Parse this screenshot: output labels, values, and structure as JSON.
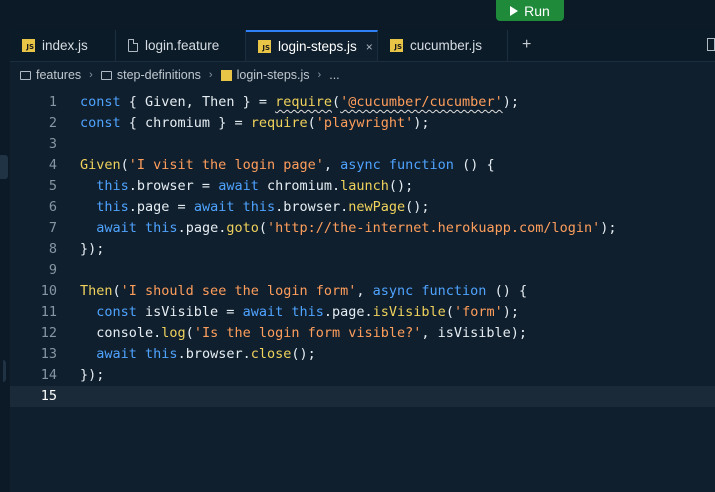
{
  "toolbar": {
    "run_label": "Run"
  },
  "tabs": [
    {
      "label": "index.js",
      "icon": "js-file-icon",
      "active": false
    },
    {
      "label": "login.feature",
      "icon": "file-icon",
      "active": false
    },
    {
      "label": "login-steps.js",
      "icon": "js-file-icon",
      "active": true,
      "closable": true
    },
    {
      "label": "cucumber.js",
      "icon": "js-file-icon",
      "active": false
    }
  ],
  "icons": {
    "close": "×",
    "plus": "+",
    "chevron": "›",
    "js_badge": "JS"
  },
  "breadcrumb": {
    "items": [
      "features",
      "step-definitions",
      "login-steps.js"
    ],
    "ellipsis": "..."
  },
  "editor": {
    "current_line": 15,
    "lines": [
      {
        "n": "1",
        "tokens": [
          [
            "kw",
            "const"
          ],
          [
            "pl",
            " { "
          ],
          [
            "pl",
            "Given"
          ],
          [
            "pl",
            ", "
          ],
          [
            "pl",
            "Then"
          ],
          [
            "pl",
            " } = "
          ],
          [
            "fn sq",
            "require"
          ],
          [
            "pl",
            "("
          ],
          [
            "str sq",
            "'@cucumber/cucumber'"
          ],
          [
            "pl",
            ");"
          ]
        ]
      },
      {
        "n": "2",
        "tokens": [
          [
            "kw",
            "const"
          ],
          [
            "pl",
            " { "
          ],
          [
            "pl",
            "chromium"
          ],
          [
            "pl",
            " } = "
          ],
          [
            "fn",
            "require"
          ],
          [
            "pl",
            "("
          ],
          [
            "str",
            "'playwright'"
          ],
          [
            "pl",
            ");"
          ]
        ]
      },
      {
        "n": "3",
        "tokens": []
      },
      {
        "n": "4",
        "tokens": [
          [
            "fn",
            "Given"
          ],
          [
            "pl",
            "("
          ],
          [
            "str",
            "'I visit the login page'"
          ],
          [
            "pl",
            ", "
          ],
          [
            "kw",
            "async"
          ],
          [
            "pl",
            " "
          ],
          [
            "kw",
            "function"
          ],
          [
            "pl",
            " () {"
          ]
        ]
      },
      {
        "n": "5",
        "tokens": [
          [
            "pl",
            "  "
          ],
          [
            "kw",
            "this"
          ],
          [
            "pl",
            ".browser = "
          ],
          [
            "kw",
            "await"
          ],
          [
            "pl",
            " chromium."
          ],
          [
            "fn",
            "launch"
          ],
          [
            "pl",
            "();"
          ]
        ]
      },
      {
        "n": "6",
        "tokens": [
          [
            "pl",
            "  "
          ],
          [
            "kw",
            "this"
          ],
          [
            "pl",
            ".page = "
          ],
          [
            "kw",
            "await"
          ],
          [
            "pl",
            " "
          ],
          [
            "kw",
            "this"
          ],
          [
            "pl",
            ".browser."
          ],
          [
            "fn",
            "newPage"
          ],
          [
            "pl",
            "();"
          ]
        ]
      },
      {
        "n": "7",
        "tokens": [
          [
            "pl",
            "  "
          ],
          [
            "kw",
            "await"
          ],
          [
            "pl",
            " "
          ],
          [
            "kw",
            "this"
          ],
          [
            "pl",
            ".page."
          ],
          [
            "fn",
            "goto"
          ],
          [
            "pl",
            "("
          ],
          [
            "str",
            "'http://the-internet.herokuapp.com/login'"
          ],
          [
            "pl",
            ");"
          ]
        ]
      },
      {
        "n": "8",
        "tokens": [
          [
            "pl",
            "});"
          ]
        ]
      },
      {
        "n": "9",
        "tokens": []
      },
      {
        "n": "10",
        "tokens": [
          [
            "fn",
            "Then"
          ],
          [
            "pl",
            "("
          ],
          [
            "str",
            "'I should see the login form'"
          ],
          [
            "pl",
            ", "
          ],
          [
            "kw",
            "async"
          ],
          [
            "pl",
            " "
          ],
          [
            "kw",
            "function"
          ],
          [
            "pl",
            " () {"
          ]
        ]
      },
      {
        "n": "11",
        "tokens": [
          [
            "pl",
            "  "
          ],
          [
            "kw",
            "const"
          ],
          [
            "pl",
            " isVisible = "
          ],
          [
            "kw",
            "await"
          ],
          [
            "pl",
            " "
          ],
          [
            "kw",
            "this"
          ],
          [
            "pl",
            ".page."
          ],
          [
            "fn",
            "isVisible"
          ],
          [
            "pl",
            "("
          ],
          [
            "str",
            "'form'"
          ],
          [
            "pl",
            ");"
          ]
        ]
      },
      {
        "n": "12",
        "tokens": [
          [
            "pl",
            "  console."
          ],
          [
            "fn",
            "log"
          ],
          [
            "pl",
            "("
          ],
          [
            "str",
            "'Is the login form visible?'"
          ],
          [
            "pl",
            ", isVisible);"
          ]
        ]
      },
      {
        "n": "13",
        "tokens": [
          [
            "pl",
            "  "
          ],
          [
            "kw",
            "await"
          ],
          [
            "pl",
            " "
          ],
          [
            "kw",
            "this"
          ],
          [
            "pl",
            ".browser."
          ],
          [
            "fn",
            "close"
          ],
          [
            "pl",
            "();"
          ]
        ]
      },
      {
        "n": "14",
        "tokens": [
          [
            "pl",
            "});"
          ]
        ]
      },
      {
        "n": "15",
        "tokens": []
      }
    ]
  },
  "colors": {
    "keyword": "#4fa3ff",
    "function": "#f0d25c",
    "string": "#ff9e5c",
    "plain": "#e6edf3",
    "run_button": "#1e8a3a"
  }
}
